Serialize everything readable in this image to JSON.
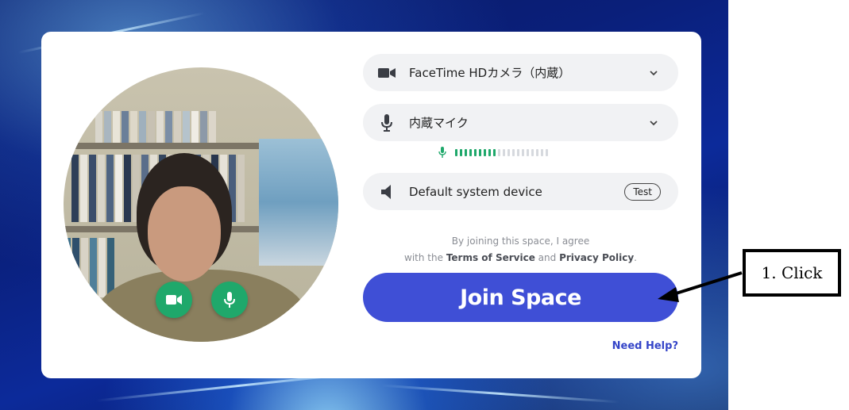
{
  "join_panel": {
    "camera_label": "FaceTime HDカメラ（内蔵）",
    "mic_label": "内蔵マイク",
    "speaker_label": "Default system device",
    "test_label": "Test",
    "agree_prefix": "By joining this space, I agree",
    "agree_with": "with the",
    "terms_label": "Terms of Service",
    "and_label": "and",
    "privacy_label": "Privacy Policy",
    "period": ".",
    "join_label": "Join Space",
    "help_label": "Need Help?"
  },
  "mic_level": {
    "active_fraction": 0.45
  },
  "annotation": {
    "callout_text": "1. Click"
  },
  "colors": {
    "accent": "#3f4fd6",
    "media_button": "#1fa86b",
    "meter_active": "#1fa86b",
    "meter_inactive": "#d6d9de"
  },
  "icons": {
    "camera": "video-camera-icon",
    "mic": "microphone-icon",
    "speaker": "speaker-icon",
    "dropdown": "chevron-down-icon"
  }
}
